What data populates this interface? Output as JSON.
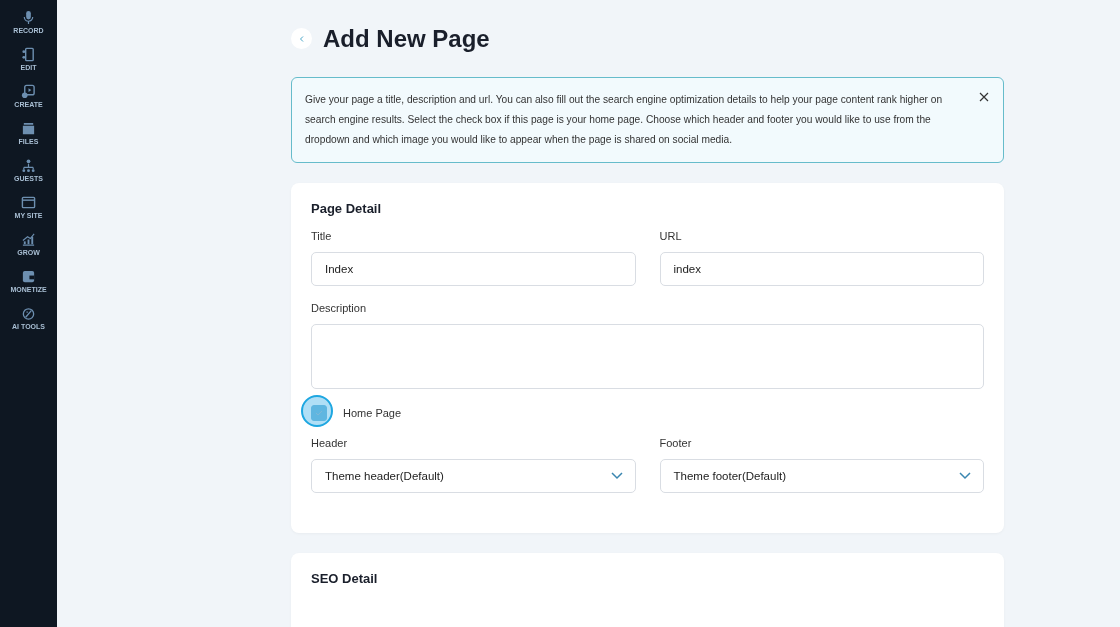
{
  "sidebar": {
    "items": [
      {
        "label": "RECORD",
        "kind": "mic"
      },
      {
        "label": "EDIT",
        "kind": "edit"
      },
      {
        "label": "CREATE",
        "kind": "create"
      },
      {
        "label": "FILES",
        "kind": "files"
      },
      {
        "label": "GUESTS",
        "kind": "guests"
      },
      {
        "label": "MY SITE",
        "kind": "site"
      },
      {
        "label": "GROW",
        "kind": "grow"
      },
      {
        "label": "MONETIZE",
        "kind": "monetize"
      },
      {
        "label": "AI TOOLS",
        "kind": "ai"
      }
    ]
  },
  "page_title": "Add New Page",
  "info_banner": {
    "text": "Give your page a title, description and url. You can also fill out the search engine optimization details to help your page content rank higher on search engine results. Select the check box if this page is your home page. Choose which header and footer you would like to use from the dropdown and which image you would like to appear when the page is shared on social media."
  },
  "page_detail": {
    "heading": "Page Detail",
    "title_field": {
      "label": "Title",
      "value": "Index"
    },
    "url_field": {
      "label": "URL",
      "value": "index"
    },
    "description_field": {
      "label": "Description"
    },
    "home_page": {
      "label": "Home Page",
      "checked": true
    },
    "header_select": {
      "label": "Header",
      "value": "Theme header(Default)"
    },
    "footer_select": {
      "label": "Footer",
      "value": "Theme footer(Default)"
    }
  },
  "seo_detail": {
    "heading": "SEO Detail"
  }
}
